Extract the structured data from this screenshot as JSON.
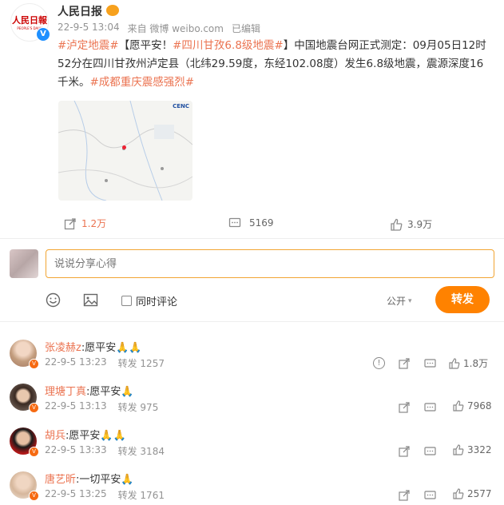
{
  "post": {
    "author": "人民日报",
    "verified_badge": "V",
    "logo_text": "人民日報",
    "logo_sub": "PEOPLE'S DAILY",
    "time": "22-9-5 13:04",
    "source": "来自 微博 weibo.com",
    "edited": "已编辑",
    "content": {
      "tag1": "#泸定地震#",
      "text1": "【愿平安！",
      "tag2": "#四川甘孜6.8级地震#",
      "text2": "】中国地震台网正式测定：09月05日12时52分在四川甘孜州泸定县（北纬29.59度，东经102.08度）发生6.8级地震，震源深度16千米。",
      "tag3": "#成都重庆震感强烈#"
    },
    "map_logo": "CENC",
    "repost_count": "1.2万",
    "comment_count": "5169",
    "like_count": "3.9万"
  },
  "composer": {
    "placeholder": "说说分享心得",
    "also_comment": "同时评论",
    "visibility": "公开",
    "submit": "转发"
  },
  "comments": [
    {
      "name": "张凌赫z",
      "text": ":愿平安🙏🙏",
      "time": "22-9-5 13:23",
      "repost": "转发 1257",
      "likes": "1.8万",
      "has_report": true
    },
    {
      "name": "理塘丁真",
      "text": ":愿平安🙏",
      "time": "22-9-5 13:13",
      "repost": "转发 975",
      "likes": "7968",
      "has_report": false
    },
    {
      "name": "胡兵",
      "text": ":愿平安🙏🙏",
      "time": "22-9-5 13:33",
      "repost": "转发 3184",
      "likes": "3322",
      "has_report": false
    },
    {
      "name": "唐艺昕",
      "text": ":一切平安🙏",
      "time": "22-9-5 13:25",
      "repost": "转发 1761",
      "likes": "2577",
      "has_report": false
    }
  ],
  "colors": {
    "accent": "#eb7350",
    "button": "#ff8200",
    "verified": "#1e90ff",
    "input_border": "#f2a533"
  }
}
